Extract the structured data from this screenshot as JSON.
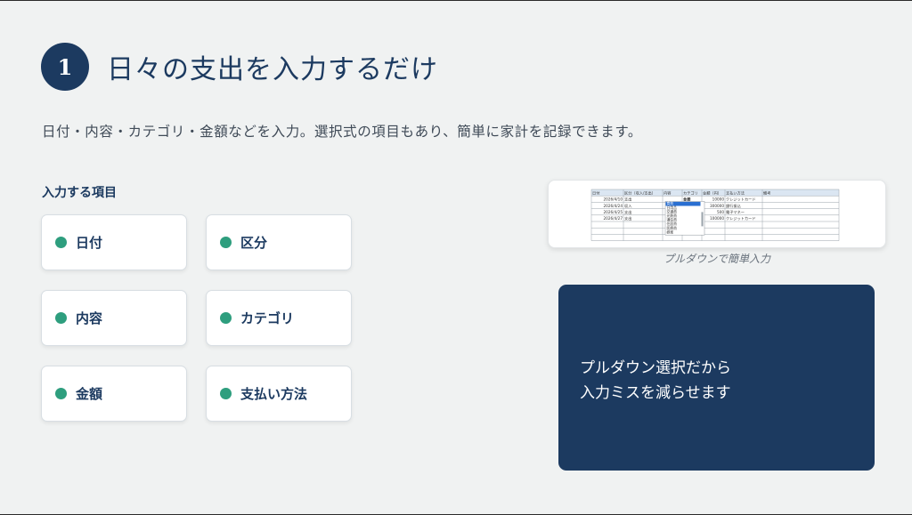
{
  "header": {
    "step_number": "1",
    "title": "日々の支出を入力するだけ"
  },
  "subtitle": "日付・内容・カテゴリ・金額などを入力。選択式の項目もあり、簡単に家計を記録できます。",
  "fields_section": {
    "label": "入力する項目",
    "fields": [
      {
        "label": "日付"
      },
      {
        "label": "区分"
      },
      {
        "label": "内容"
      },
      {
        "label": "カテゴリ"
      },
      {
        "label": "金額"
      },
      {
        "label": "支払い方法"
      }
    ]
  },
  "spreadsheet": {
    "headers": [
      "日付",
      "区分（収入/支出）",
      "内容",
      "カテゴリ",
      "金額（円）",
      "支払い方法",
      "備考"
    ],
    "rows": [
      [
        "2026/4/10",
        "支出",
        "",
        "食費",
        "10000",
        "クレジットカード",
        ""
      ],
      [
        "2026/4/24",
        "収入",
        "",
        "",
        "300000",
        "銀行振込",
        ""
      ],
      [
        "2026/4/25",
        "支出",
        "",
        "",
        "500",
        "電子マネー",
        ""
      ],
      [
        "2026/4/27",
        "支出",
        "",
        "",
        "100000",
        "クレジットカード",
        ""
      ]
    ],
    "dropdown_options": [
      "食費",
      "日用品",
      "交通費",
      "光熱費",
      "通信費",
      "住居費",
      "医療費",
      "娯楽"
    ],
    "dropdown_header_value": "金額"
  },
  "caption": "プルダウンで簡単入力",
  "callout": {
    "line1": "プルダウン選択だから",
    "line2": "入力ミスを減らせます"
  },
  "colors": {
    "accent_navy": "#1c3a60",
    "dot_green": "#2e9e7e",
    "background": "#f0f2f2"
  }
}
